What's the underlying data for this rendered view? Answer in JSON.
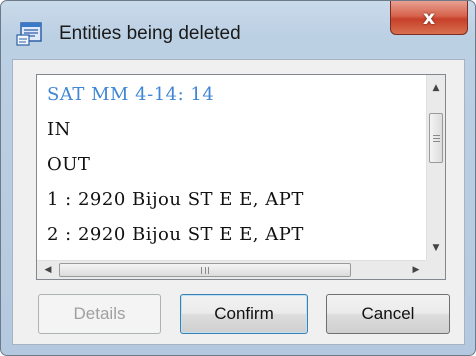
{
  "window": {
    "title": "Entities being deleted",
    "close_glyph": "x"
  },
  "list": {
    "lines": [
      {
        "text": "SAT MM 4-14: 14",
        "color": "#3f86d4"
      },
      {
        "text": "IN"
      },
      {
        "text": "OUT"
      },
      {
        "text": "1 : 2920 Bijou ST E E, APT"
      },
      {
        "text": "2 : 2920 Bijou ST E E, APT"
      }
    ],
    "scroll": {
      "up_arrow": "▲",
      "down_arrow": "▼",
      "left_arrow": "◀",
      "right_arrow": "▶"
    }
  },
  "buttons": {
    "details": "Details",
    "confirm": "Confirm",
    "cancel": "Cancel"
  },
  "colors": {
    "highlight": "#3f86d4",
    "close_button": "#c7402a"
  },
  "icons": {
    "app": "list-window-icon",
    "close": "close-icon"
  }
}
